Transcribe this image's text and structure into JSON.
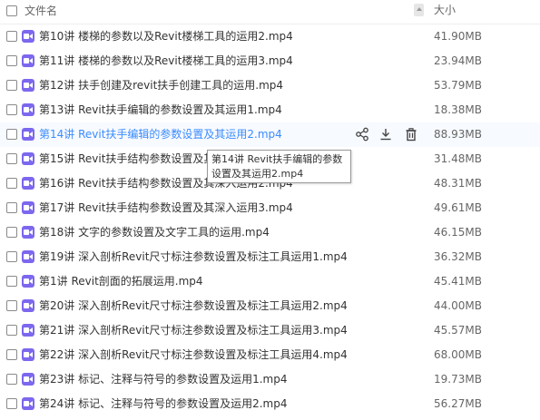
{
  "header": {
    "name_col": "文件名",
    "size_col": "大小"
  },
  "files": [
    {
      "name": "第10讲 楼梯的参数以及Revit楼梯工具的运用2.mp4",
      "size": "41.90MB"
    },
    {
      "name": "第11讲 楼梯的参数以及Revit楼梯工具的运用3.mp4",
      "size": "23.94MB"
    },
    {
      "name": "第12讲 扶手创建及revit扶手创建工具的运用.mp4",
      "size": "53.79MB"
    },
    {
      "name": "第13讲 Revit扶手编辑的参数设置及其运用1.mp4",
      "size": "18.38MB"
    },
    {
      "name": "第14讲 Revit扶手编辑的参数设置及其运用2.mp4",
      "size": "88.93MB"
    },
    {
      "name": "第15讲 Revit扶手结构参数设置及其深入运用1.mp4",
      "size": "31.48MB"
    },
    {
      "name": "第16讲 Revit扶手结构参数设置及其深入运用2.mp4",
      "size": "48.31MB"
    },
    {
      "name": "第17讲 Revit扶手结构参数设置及其深入运用3.mp4",
      "size": "49.61MB"
    },
    {
      "name": "第18讲 文字的参数设置及文字工具的运用.mp4",
      "size": "46.15MB"
    },
    {
      "name": "第19讲 深入剖析Revit尺寸标注参数设置及标注工具运用1.mp4",
      "size": "36.32MB"
    },
    {
      "name": "第1讲 Revit剖面的拓展运用.mp4",
      "size": "45.41MB"
    },
    {
      "name": "第20讲 深入剖析Revit尺寸标注参数设置及标注工具运用2.mp4",
      "size": "44.00MB"
    },
    {
      "name": "第21讲 深入剖析Revit尺寸标注参数设置及标注工具运用3.mp4",
      "size": "45.57MB"
    },
    {
      "name": "第22讲 深入剖析Revit尺寸标注参数设置及标注工具运用4.mp4",
      "size": "68.00MB"
    },
    {
      "name": "第23讲 标记、注释与符号的参数设置及运用1.mp4",
      "size": "19.73MB"
    },
    {
      "name": "第24讲 标记、注释与符号的参数设置及运用2.mp4",
      "size": "56.27MB"
    }
  ],
  "hover_row_index": 4,
  "tooltip": "第14讲 Revit扶手编辑的参数设置及其运用2.mp4",
  "icons": {
    "file": "video-file-icon",
    "share": "share-icon",
    "download": "download-icon",
    "delete": "trash-icon"
  },
  "colors": {
    "accent": "#3b8cff",
    "file_icon": "#7b68ee"
  }
}
